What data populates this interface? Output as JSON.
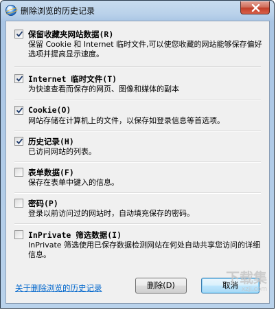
{
  "window": {
    "title": "删除浏览的历史记录",
    "close_symbol": "✕"
  },
  "options": [
    {
      "key": "favorites",
      "title": "保留收藏夹网站数据(R)",
      "checked": true,
      "desc": "保留 Cookie 和 Internet 临时文件,可以使您收藏的网站能够保存偏好选项并提高显示速度。"
    },
    {
      "key": "temp_files",
      "title": "Internet 临时文件(T)",
      "checked": true,
      "desc": "为快速查看而保存的网页、图像和媒体的副本"
    },
    {
      "key": "cookies",
      "title": "Cookie(O)",
      "checked": true,
      "desc": "网站存储在计算机上的文件，以保存如登录信息等首选项。"
    },
    {
      "key": "history",
      "title": "历史记录(H)",
      "checked": true,
      "desc": "已访问网站的列表。"
    },
    {
      "key": "form_data",
      "title": "表单数据(F)",
      "checked": false,
      "desc": "保存在表单中键入的信息。"
    },
    {
      "key": "passwords",
      "title": "密码(P)",
      "checked": false,
      "desc": "登录以前访问过的网站时，自动填充保存的密码。"
    },
    {
      "key": "inprivate",
      "title": "InPrivate 筛选数据(I)",
      "checked": false,
      "desc": "InPrivate 筛选使用已保存数据检测网站在何处自动共享您访问的详细信息。"
    }
  ],
  "footer": {
    "link_text": "关于删除浏览的历史记录",
    "delete_label": "删除(D)",
    "cancel_label": "取消"
  },
  "watermark": {
    "text": "下载集",
    "sub": "xzji.com"
  }
}
